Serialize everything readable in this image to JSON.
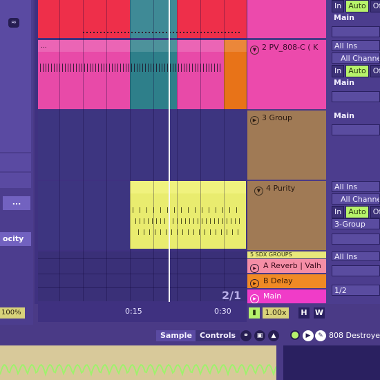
{
  "sidebar": {
    "search_icon_label": "≈",
    "more_button": "...",
    "velocity_label": "ocity",
    "zoom": "100%"
  },
  "tracks": [
    {
      "name": "2 PV_808-C ( K",
      "color": "#ec4aac"
    },
    {
      "name": "3 Group",
      "color": "#a07a55"
    },
    {
      "name": "4 Purity",
      "color": "#a07a55"
    },
    {
      "name": "5 SDX GROUPS",
      "color": "#e8e87a"
    }
  ],
  "returns": [
    {
      "name": "A Reverb | Valh",
      "color": "#f58ea6"
    },
    {
      "name": "B Delay",
      "color": "#f08a25"
    },
    {
      "name": "Main",
      "color": "#f03cc8"
    }
  ],
  "io": {
    "top_in": "In",
    "top_auto": "Auto",
    "top_off": "Of",
    "top_main": "Main",
    "t2_input": "All Ins",
    "t2_channel": "All Channe",
    "t2_in": "In",
    "t2_auto": "Auto",
    "t2_off": "Of",
    "t2_main": "Main",
    "t3_main": "Main",
    "t4_input": "All Ins",
    "t4_channel": "All Channe",
    "t4_in": "In",
    "t4_auto": "Auto",
    "t4_off": "Of",
    "t4_group": "3-Group",
    "t5_input": "All Ins",
    "ret_ratio": "1/2"
  },
  "timeline": {
    "marker_15": "0:15",
    "marker_30": "0:30",
    "page": "2/1",
    "tempo_factor": "1.00x",
    "h_button": "H",
    "w_button": "W"
  },
  "detail": {
    "sample_tab": "Sample",
    "controls_tab": "Controls",
    "device_name": "808 Destroye"
  },
  "colors": {
    "red_clip": "#ee2f4a",
    "pink_clip": "#e84aa8",
    "teal_clip": "#2e7f8a",
    "orange_clip": "#e87318",
    "yellow_clip": "#e9ec6f",
    "waveform": "#b6f26c"
  }
}
